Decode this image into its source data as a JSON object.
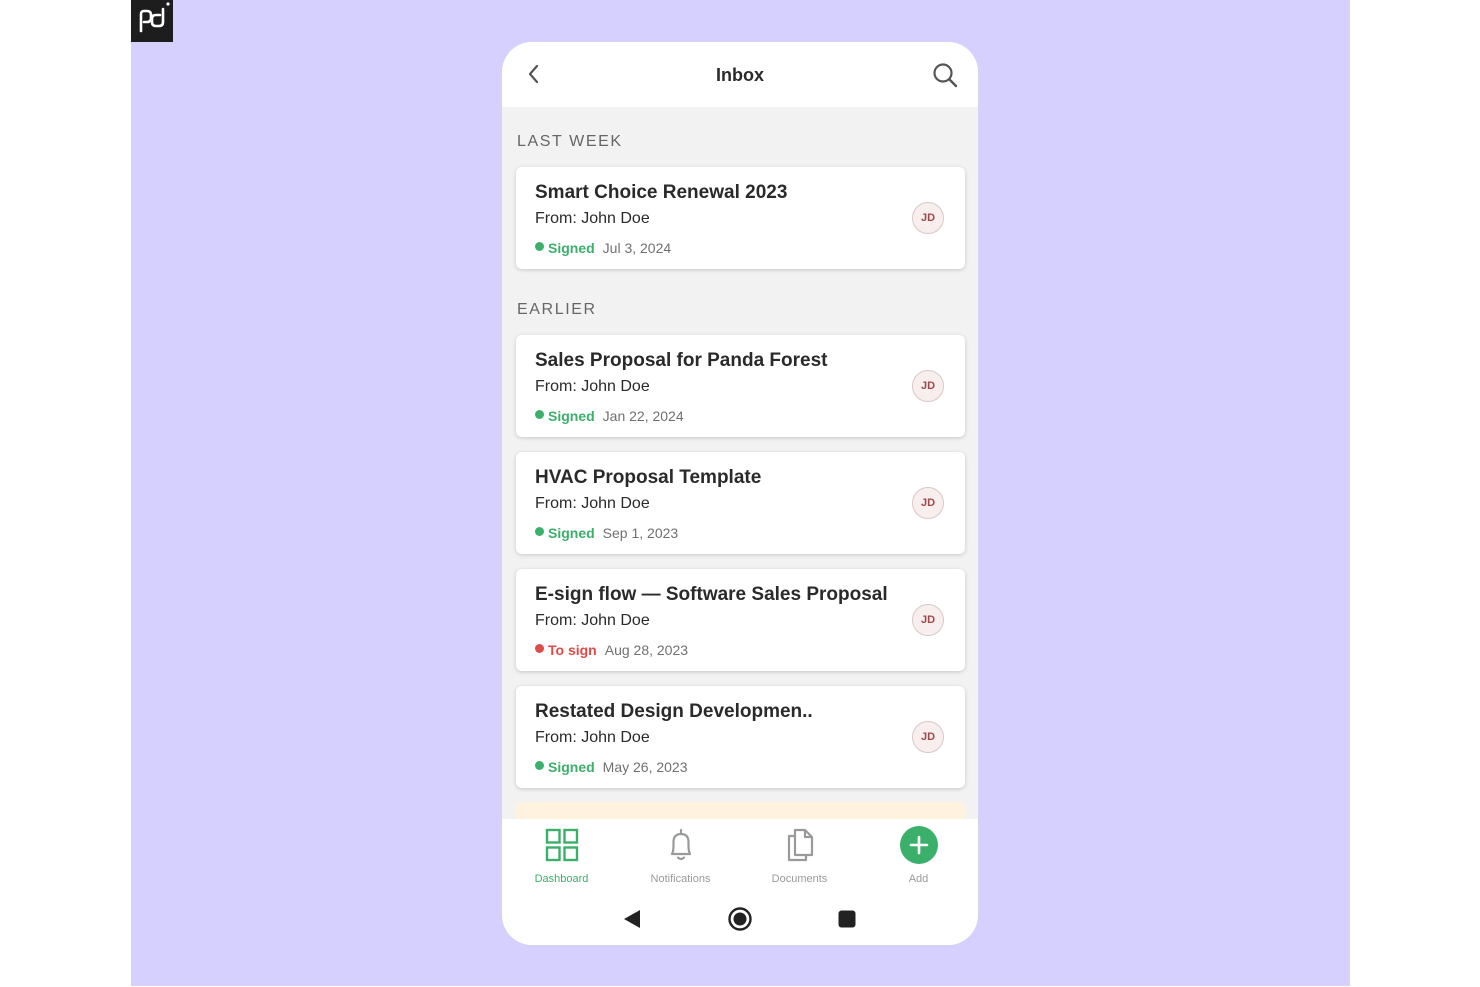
{
  "colors": {
    "background": "#d5d0fd",
    "accent": "#3bb06a",
    "signed": "#3bb06a",
    "to_sign": "#e04a48"
  },
  "header": {
    "title": "Inbox",
    "back_icon": "chevron-left-icon",
    "search_icon": "search-icon"
  },
  "sections": {
    "last_week": "LAST WEEK",
    "earlier": "EARLIER"
  },
  "documents": [
    {
      "title": "Smart Choice Renewal 2023",
      "from": "From: John Doe",
      "status": "Signed",
      "status_type": "signed",
      "date": "Jul 3, 2024",
      "avatar": "JD"
    },
    {
      "title": "Sales Proposal for Panda Forest",
      "from": "From: John Doe",
      "status": "Signed",
      "status_type": "signed",
      "date": "Jan 22, 2024",
      "avatar": "JD"
    },
    {
      "title": "HVAC Proposal Template",
      "from": "From: John Doe",
      "status": "Signed",
      "status_type": "signed",
      "date": "Sep 1, 2023",
      "avatar": "JD"
    },
    {
      "title": "E-sign flow — Software Sales Proposal",
      "from": "From: John Doe",
      "status": "To sign",
      "status_type": "to_sign",
      "date": "Aug 28, 2023",
      "avatar": "JD"
    },
    {
      "title": "Restated Design Developmen..",
      "from": "From: John Doe",
      "status": "Signed",
      "status_type": "signed",
      "date": "May 26, 2023",
      "avatar": "JD"
    }
  ],
  "tabs": [
    {
      "label": "Dashboard",
      "icon": "dashboard-grid-icon",
      "active": true
    },
    {
      "label": "Notifications",
      "icon": "bell-icon",
      "active": false
    },
    {
      "label": "Documents",
      "icon": "documents-icon",
      "active": false
    },
    {
      "label": "Add",
      "icon": "plus-icon",
      "active": false
    }
  ],
  "system_nav": [
    "back-triangle-icon",
    "home-circle-icon",
    "recents-square-icon"
  ]
}
